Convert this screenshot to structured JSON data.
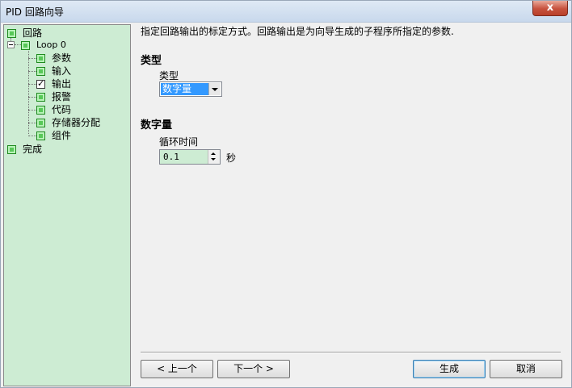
{
  "window": {
    "title": "PID 回路向导",
    "close_label": "x"
  },
  "tree": {
    "items": [
      {
        "label": "回路",
        "checked": false
      },
      {
        "label": "Loop 0",
        "checked": false
      },
      {
        "label": "参数",
        "checked": false
      },
      {
        "label": "输入",
        "checked": false
      },
      {
        "label": "输出",
        "checked": true
      },
      {
        "label": "报警",
        "checked": false
      },
      {
        "label": "代码",
        "checked": false
      },
      {
        "label": "存储器分配",
        "checked": false
      },
      {
        "label": "组件",
        "checked": false
      },
      {
        "label": "完成",
        "checked": false
      }
    ]
  },
  "main": {
    "description": "指定回路输出的标定方式。回路输出是为向导生成的子程序所指定的参数.",
    "type_section": {
      "title": "类型",
      "field_label": "类型",
      "selected": "数字量"
    },
    "digital_section": {
      "title": "数字量",
      "field_label": "循环时间",
      "value": "0.1",
      "unit": "秒"
    }
  },
  "buttons": {
    "prev": "< 上一个",
    "next": "下一个 >",
    "generate": "生成",
    "cancel": "取消"
  }
}
